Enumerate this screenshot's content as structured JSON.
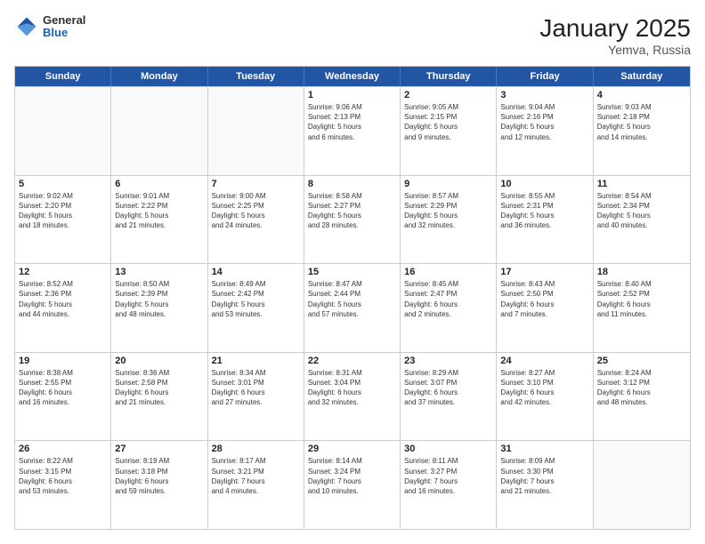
{
  "logo": {
    "general": "General",
    "blue": "Blue"
  },
  "title": {
    "month": "January 2025",
    "location": "Yemva, Russia"
  },
  "calendar": {
    "days": [
      "Sunday",
      "Monday",
      "Tuesday",
      "Wednesday",
      "Thursday",
      "Friday",
      "Saturday"
    ],
    "rows": [
      [
        {
          "day": "",
          "text": ""
        },
        {
          "day": "",
          "text": ""
        },
        {
          "day": "",
          "text": ""
        },
        {
          "day": "1",
          "text": "Sunrise: 9:06 AM\nSunset: 2:13 PM\nDaylight: 5 hours\nand 6 minutes."
        },
        {
          "day": "2",
          "text": "Sunrise: 9:05 AM\nSunset: 2:15 PM\nDaylight: 5 hours\nand 9 minutes."
        },
        {
          "day": "3",
          "text": "Sunrise: 9:04 AM\nSunset: 2:16 PM\nDaylight: 5 hours\nand 12 minutes."
        },
        {
          "day": "4",
          "text": "Sunrise: 9:03 AM\nSunset: 2:18 PM\nDaylight: 5 hours\nand 14 minutes."
        }
      ],
      [
        {
          "day": "5",
          "text": "Sunrise: 9:02 AM\nSunset: 2:20 PM\nDaylight: 5 hours\nand 18 minutes."
        },
        {
          "day": "6",
          "text": "Sunrise: 9:01 AM\nSunset: 2:22 PM\nDaylight: 5 hours\nand 21 minutes."
        },
        {
          "day": "7",
          "text": "Sunrise: 9:00 AM\nSunset: 2:25 PM\nDaylight: 5 hours\nand 24 minutes."
        },
        {
          "day": "8",
          "text": "Sunrise: 8:58 AM\nSunset: 2:27 PM\nDaylight: 5 hours\nand 28 minutes."
        },
        {
          "day": "9",
          "text": "Sunrise: 8:57 AM\nSunset: 2:29 PM\nDaylight: 5 hours\nand 32 minutes."
        },
        {
          "day": "10",
          "text": "Sunrise: 8:55 AM\nSunset: 2:31 PM\nDaylight: 5 hours\nand 36 minutes."
        },
        {
          "day": "11",
          "text": "Sunrise: 8:54 AM\nSunset: 2:34 PM\nDaylight: 5 hours\nand 40 minutes."
        }
      ],
      [
        {
          "day": "12",
          "text": "Sunrise: 8:52 AM\nSunset: 2:36 PM\nDaylight: 5 hours\nand 44 minutes."
        },
        {
          "day": "13",
          "text": "Sunrise: 8:50 AM\nSunset: 2:39 PM\nDaylight: 5 hours\nand 48 minutes."
        },
        {
          "day": "14",
          "text": "Sunrise: 8:49 AM\nSunset: 2:42 PM\nDaylight: 5 hours\nand 53 minutes."
        },
        {
          "day": "15",
          "text": "Sunrise: 8:47 AM\nSunset: 2:44 PM\nDaylight: 5 hours\nand 57 minutes."
        },
        {
          "day": "16",
          "text": "Sunrise: 8:45 AM\nSunset: 2:47 PM\nDaylight: 6 hours\nand 2 minutes."
        },
        {
          "day": "17",
          "text": "Sunrise: 8:43 AM\nSunset: 2:50 PM\nDaylight: 6 hours\nand 7 minutes."
        },
        {
          "day": "18",
          "text": "Sunrise: 8:40 AM\nSunset: 2:52 PM\nDaylight: 6 hours\nand 11 minutes."
        }
      ],
      [
        {
          "day": "19",
          "text": "Sunrise: 8:38 AM\nSunset: 2:55 PM\nDaylight: 6 hours\nand 16 minutes."
        },
        {
          "day": "20",
          "text": "Sunrise: 8:36 AM\nSunset: 2:58 PM\nDaylight: 6 hours\nand 21 minutes."
        },
        {
          "day": "21",
          "text": "Sunrise: 8:34 AM\nSunset: 3:01 PM\nDaylight: 6 hours\nand 27 minutes."
        },
        {
          "day": "22",
          "text": "Sunrise: 8:31 AM\nSunset: 3:04 PM\nDaylight: 6 hours\nand 32 minutes."
        },
        {
          "day": "23",
          "text": "Sunrise: 8:29 AM\nSunset: 3:07 PM\nDaylight: 6 hours\nand 37 minutes."
        },
        {
          "day": "24",
          "text": "Sunrise: 8:27 AM\nSunset: 3:10 PM\nDaylight: 6 hours\nand 42 minutes."
        },
        {
          "day": "25",
          "text": "Sunrise: 8:24 AM\nSunset: 3:12 PM\nDaylight: 6 hours\nand 48 minutes."
        }
      ],
      [
        {
          "day": "26",
          "text": "Sunrise: 8:22 AM\nSunset: 3:15 PM\nDaylight: 6 hours\nand 53 minutes."
        },
        {
          "day": "27",
          "text": "Sunrise: 8:19 AM\nSunset: 3:18 PM\nDaylight: 6 hours\nand 59 minutes."
        },
        {
          "day": "28",
          "text": "Sunrise: 8:17 AM\nSunset: 3:21 PM\nDaylight: 7 hours\nand 4 minutes."
        },
        {
          "day": "29",
          "text": "Sunrise: 8:14 AM\nSunset: 3:24 PM\nDaylight: 7 hours\nand 10 minutes."
        },
        {
          "day": "30",
          "text": "Sunrise: 8:11 AM\nSunset: 3:27 PM\nDaylight: 7 hours\nand 16 minutes."
        },
        {
          "day": "31",
          "text": "Sunrise: 8:09 AM\nSunset: 3:30 PM\nDaylight: 7 hours\nand 21 minutes."
        },
        {
          "day": "",
          "text": ""
        }
      ]
    ]
  }
}
